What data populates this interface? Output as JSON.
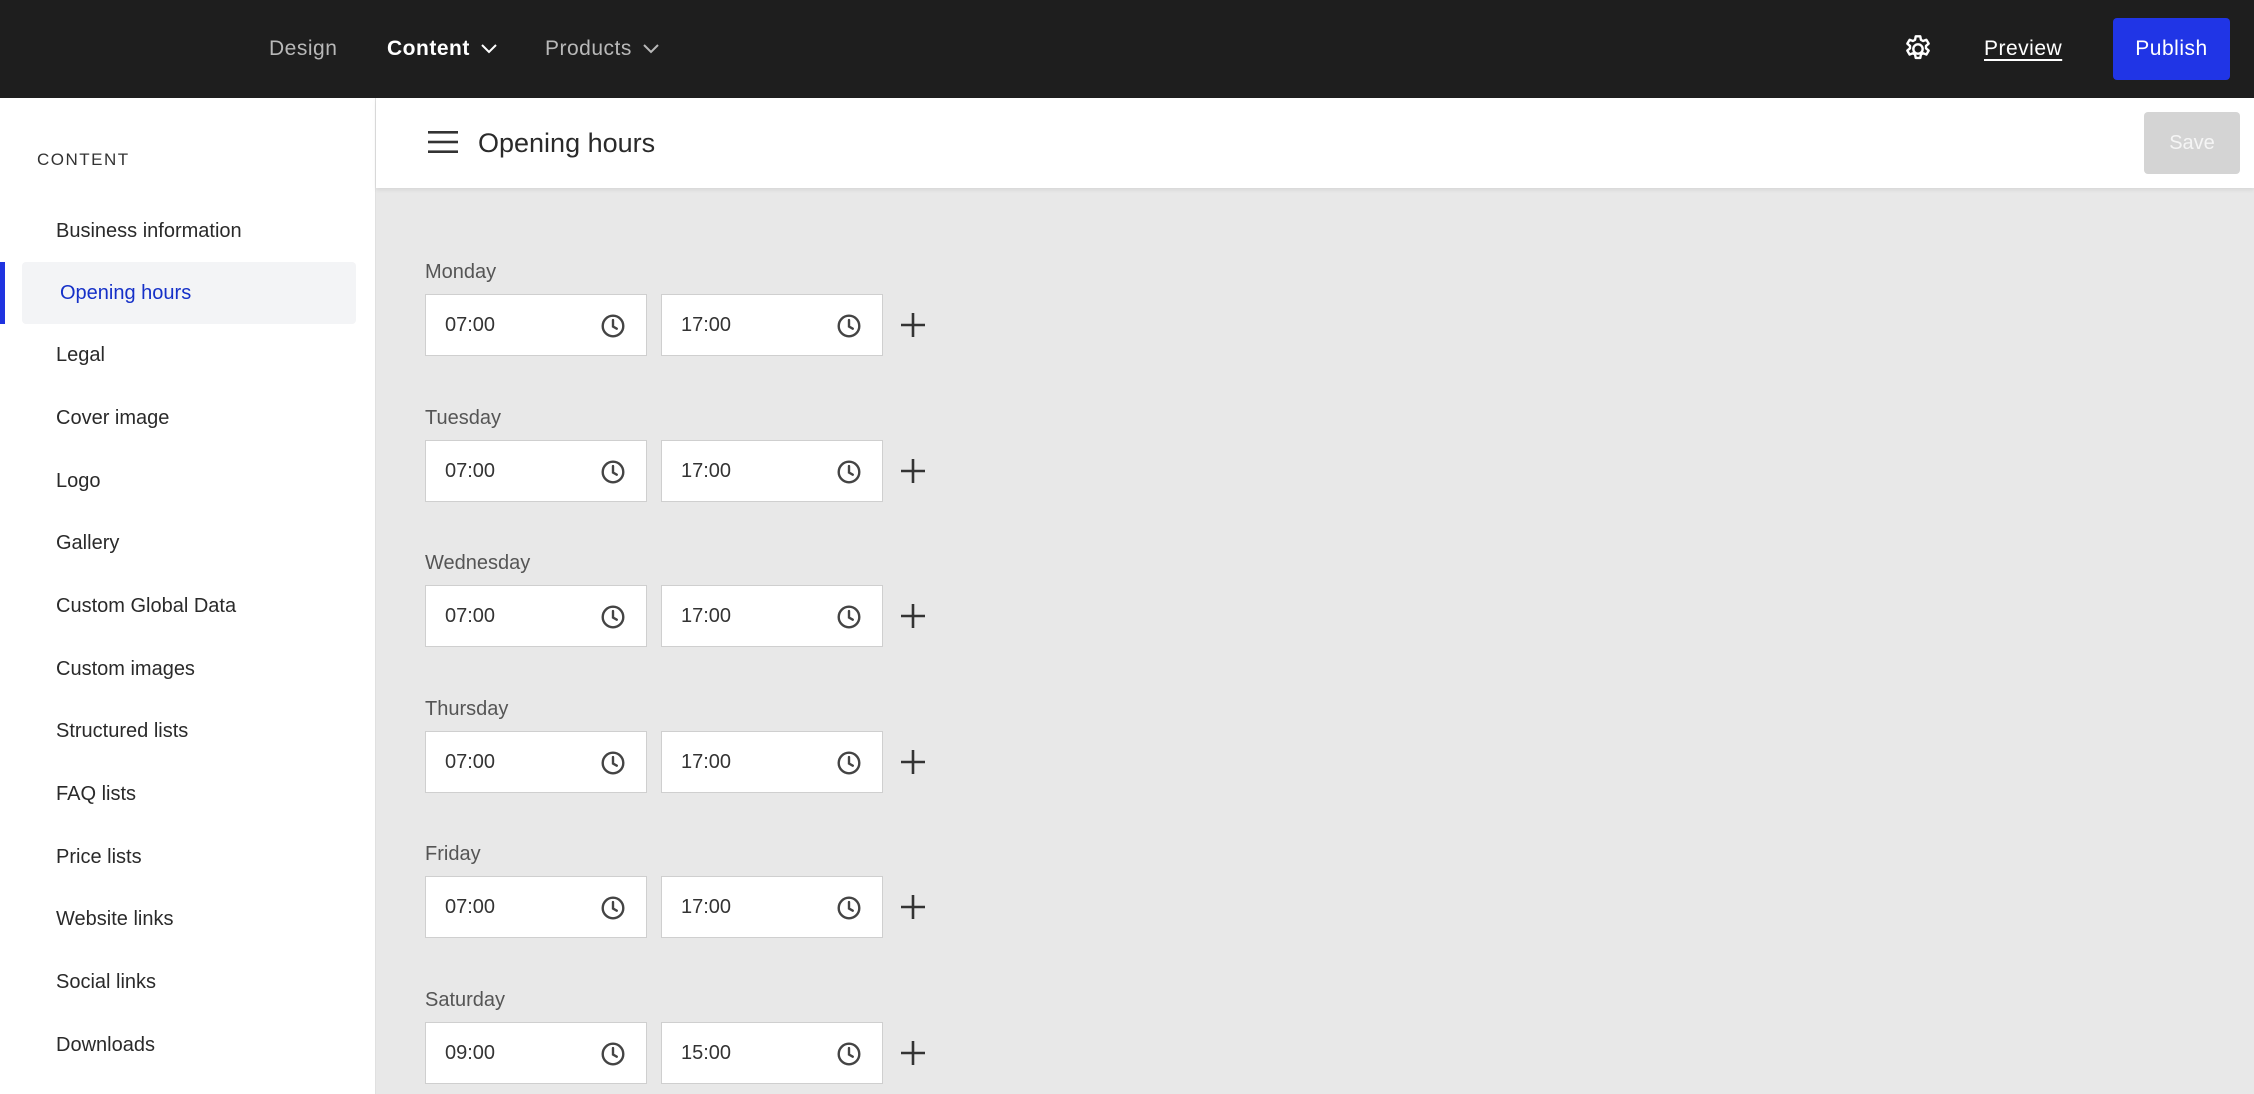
{
  "topbar": {
    "nav": [
      {
        "label": "Design",
        "has_dropdown": false
      },
      {
        "label": "Content",
        "has_dropdown": true,
        "active": true
      },
      {
        "label": "Products",
        "has_dropdown": true
      }
    ],
    "settings_icon": "gear-icon",
    "preview_label": "Preview",
    "publish_label": "Publish"
  },
  "sidebar": {
    "heading": "CONTENT",
    "items": [
      {
        "label": "Business information"
      },
      {
        "label": "Opening hours",
        "active": true
      },
      {
        "label": "Legal"
      },
      {
        "label": "Cover image"
      },
      {
        "label": "Logo"
      },
      {
        "label": "Gallery"
      },
      {
        "label": "Custom Global Data"
      },
      {
        "label": "Custom images"
      },
      {
        "label": "Structured lists"
      },
      {
        "label": "FAQ lists"
      },
      {
        "label": "Price lists"
      },
      {
        "label": "Website links"
      },
      {
        "label": "Social links"
      },
      {
        "label": "Downloads"
      }
    ]
  },
  "header": {
    "title": "Opening hours",
    "save_label": "Save"
  },
  "days": [
    {
      "name": "Monday",
      "open": "07:00",
      "close": "17:00"
    },
    {
      "name": "Tuesday",
      "open": "07:00",
      "close": "17:00"
    },
    {
      "name": "Wednesday",
      "open": "07:00",
      "close": "17:00"
    },
    {
      "name": "Thursday",
      "open": "07:00",
      "close": "17:00"
    },
    {
      "name": "Friday",
      "open": "07:00",
      "close": "17:00"
    },
    {
      "name": "Saturday",
      "open": "09:00",
      "close": "15:00"
    }
  ],
  "colors": {
    "topbar_bg": "#1e1e1e",
    "accent": "#2035e6",
    "active_text": "#1530c8",
    "content_bg": "#e8e8e8"
  }
}
